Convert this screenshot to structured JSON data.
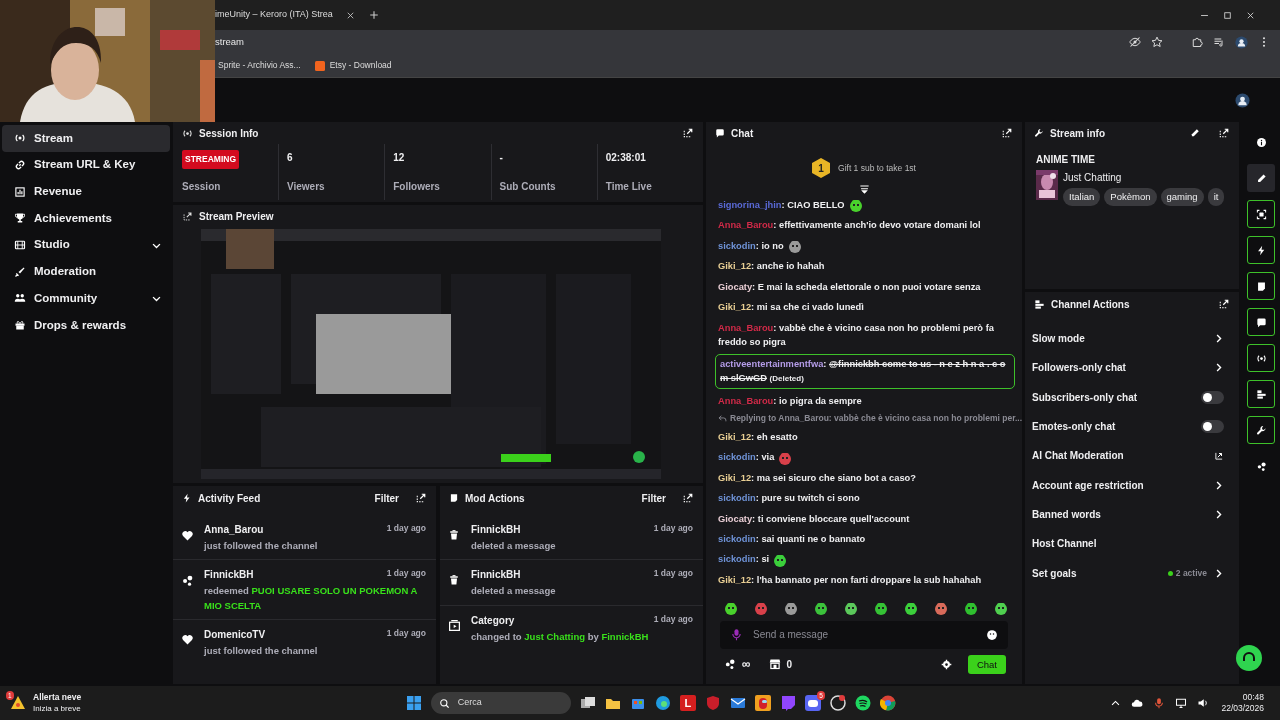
{
  "browser": {
    "tab_title": "imeUnity – Keroro (ITA) Strea",
    "address": "stream",
    "bookmarks": [
      {
        "label": "Sprite - Archivio Ass...",
        "kind": "plain"
      },
      {
        "label": "Etsy - Download",
        "kind": "shop"
      }
    ]
  },
  "sidebar": {
    "items": [
      {
        "label": "Stream",
        "selected": true,
        "expandable": false
      },
      {
        "label": "Stream URL & Key",
        "selected": false,
        "expandable": false
      },
      {
        "label": "Revenue",
        "selected": false,
        "expandable": false
      },
      {
        "label": "Achievements",
        "selected": false,
        "expandable": false
      },
      {
        "label": "Studio",
        "selected": false,
        "expandable": true
      },
      {
        "label": "Moderation",
        "selected": false,
        "expandable": false
      },
      {
        "label": "Community",
        "selected": false,
        "expandable": true
      },
      {
        "label": "Drops & rewards",
        "selected": false,
        "expandable": false
      }
    ]
  },
  "session": {
    "title": "Session Info",
    "status": "STREAMING",
    "status_label": "Session",
    "stats": [
      {
        "value": "6",
        "label": "Viewers"
      },
      {
        "value": "12",
        "label": "Followers"
      },
      {
        "value": "-",
        "label": "Sub Counts"
      },
      {
        "value": "02:38:01",
        "label": "Time Live"
      }
    ]
  },
  "preview": {
    "title": "Stream Preview"
  },
  "activity": {
    "title": "Activity Feed",
    "filter": "Filter",
    "items": [
      {
        "kind": "follow",
        "user": "Anna_Barou",
        "time": "1 day ago",
        "parts": [
          {
            "text": "just followed the channel",
            "highlight": false
          }
        ]
      },
      {
        "kind": "redeem",
        "user": "FinnickBH",
        "time": "1 day ago",
        "parts": [
          {
            "text": "redeemed",
            "highlight": false
          },
          {
            "text": "PUOI USARE SOLO UN POKEMON A MIO SCELTA",
            "highlight": true
          }
        ]
      },
      {
        "kind": "follow",
        "user": "DomenicoTV",
        "time": "1 day ago",
        "parts": [
          {
            "text": "just followed the channel",
            "highlight": false
          }
        ]
      }
    ]
  },
  "mod_actions": {
    "title": "Mod Actions",
    "filter": "Filter",
    "items": [
      {
        "kind": "delete",
        "user": "FinnickBH",
        "time": "1 day ago",
        "parts": [
          {
            "text": "deleted a message",
            "highlight": false
          }
        ]
      },
      {
        "kind": "delete",
        "user": "FinnickBH",
        "time": "1 day ago",
        "parts": [
          {
            "text": "deleted a message",
            "highlight": false
          }
        ]
      },
      {
        "kind": "category",
        "user": "Category",
        "time": "1 day ago",
        "parts": [
          {
            "text": "changed to",
            "highlight": false
          },
          {
            "text": "Just Chatting",
            "highlight": true
          },
          {
            "text": "by",
            "highlight": false
          },
          {
            "text": "FinnickBH",
            "highlight": true
          }
        ]
      }
    ]
  },
  "chat": {
    "title": "Chat",
    "gift_rank": "1",
    "gift_text": "Gift 1 sub to take 1st",
    "separator": ":",
    "messages": [
      {
        "kind": "message",
        "user": "signorina_jhin",
        "color": "#5a6ad8",
        "text": "CIAO BELLO",
        "emote": true,
        "deleted": false
      },
      {
        "kind": "message",
        "user": "Anna_Barou",
        "color": "#d02a48",
        "text": "effettivamente anch'io devo votare domani lol",
        "emote": false,
        "deleted": false
      },
      {
        "kind": "message",
        "user": "sickodin",
        "color": "#6f93d8",
        "text": "io no",
        "emote": true,
        "deleted": false
      },
      {
        "kind": "message",
        "user": "Giki_12",
        "color": "#e9cf94",
        "text": "anche io hahah",
        "emote": false,
        "deleted": false
      },
      {
        "kind": "message",
        "user": "Giocaty",
        "color": "#e8cdd4",
        "text": "E mai la scheda elettorale o non puoi votare senza",
        "emote": false,
        "deleted": false
      },
      {
        "kind": "message",
        "user": "Giki_12",
        "color": "#e9cf94",
        "text": "mi sa che ci vado lunedì",
        "emote": false,
        "deleted": false
      },
      {
        "kind": "message",
        "user": "Anna_Barou",
        "color": "#d02a48",
        "text": "vabbè che è vicino casa non ho problemi però fa freddo so pigra",
        "emote": false,
        "deleted": false
      },
      {
        "kind": "message",
        "user": "activeentertainmentfwa",
        "color": "#b49ce8",
        "text": "@finnickbh come to us - n e z h n a . c o m slGwGD",
        "note": "(Deleted)",
        "emote": false,
        "deleted": true
      },
      {
        "kind": "message",
        "user": "Anna_Barou",
        "color": "#d02a48",
        "text": "io pigra da sempre",
        "emote": false,
        "deleted": false
      },
      {
        "kind": "reply",
        "text": "Replying to Anna_Barou: vabbè che è vicino casa non ho problemi per..."
      },
      {
        "kind": "message",
        "user": "Giki_12",
        "color": "#e9cf94",
        "text": "eh esatto",
        "emote": false,
        "deleted": false
      },
      {
        "kind": "message",
        "user": "sickodin",
        "color": "#6f93d8",
        "text": "via",
        "emote": true,
        "deleted": false
      },
      {
        "kind": "message",
        "user": "Giki_12",
        "color": "#e9cf94",
        "text": "ma sei sicuro che siano bot a caso?",
        "emote": false,
        "deleted": false
      },
      {
        "kind": "message",
        "user": "sickodin",
        "color": "#6f93d8",
        "text": "pure su twitch ci sono",
        "emote": false,
        "deleted": false
      },
      {
        "kind": "message",
        "user": "Giocaty",
        "color": "#e8cdd4",
        "text": "ti conviene bloccare quell'account",
        "emote": false,
        "deleted": false
      },
      {
        "kind": "message",
        "user": "sickodin",
        "color": "#6f93d8",
        "text": "sai quanti ne o bannato",
        "emote": false,
        "deleted": false
      },
      {
        "kind": "message",
        "user": "sickodin",
        "color": "#6f93d8",
        "text": "si",
        "emote": true,
        "deleted": false
      },
      {
        "kind": "message",
        "user": "Giki_12",
        "color": "#e9cf94",
        "text": "l'ha bannato per non farti droppare la sub hahahah",
        "emote": false,
        "deleted": false
      }
    ],
    "placeholder": "Send a message",
    "points": "∞",
    "bits": "0",
    "send": "Chat"
  },
  "stream_info": {
    "title": "Stream info",
    "stream_title": "ANIME TIME",
    "category": "Just Chatting",
    "tags": [
      "Italian",
      "Pokèmon",
      "gaming",
      "it"
    ]
  },
  "channel_actions": {
    "title": "Channel Actions",
    "items": [
      {
        "kind": "link",
        "label": "Slow mode"
      },
      {
        "kind": "link",
        "label": "Followers-only chat"
      },
      {
        "kind": "toggle",
        "label": "Subscribers-only chat",
        "on": false
      },
      {
        "kind": "toggle",
        "label": "Emotes-only chat",
        "on": false
      },
      {
        "kind": "external",
        "label": "AI Chat Moderation"
      },
      {
        "kind": "link",
        "label": "Account age restriction"
      },
      {
        "kind": "link",
        "label": "Banned words"
      },
      {
        "kind": "plain",
        "label": "Host Channel"
      },
      {
        "kind": "goals",
        "label": "Set goals",
        "badge": "2 active"
      }
    ]
  },
  "rail": {
    "items": [
      {
        "pinned": false,
        "selected": false
      },
      {
        "pinned": false,
        "selected": true
      },
      {
        "pinned": true,
        "selected": false
      },
      {
        "pinned": true,
        "selected": false
      },
      {
        "pinned": true,
        "selected": false
      },
      {
        "pinned": true,
        "selected": false
      },
      {
        "pinned": true,
        "selected": false
      },
      {
        "pinned": true,
        "selected": false
      },
      {
        "pinned": true,
        "selected": false
      },
      {
        "pinned": false,
        "selected": false
      }
    ]
  },
  "taskbar": {
    "weather_badge": "1",
    "weather_title": "Allerta neve",
    "weather_sub": "Inizia a breve",
    "search_placeholder": "Cerca",
    "letter_app": "L",
    "discord_badge": "5",
    "time": "00:48",
    "date": "22/03/2026"
  }
}
